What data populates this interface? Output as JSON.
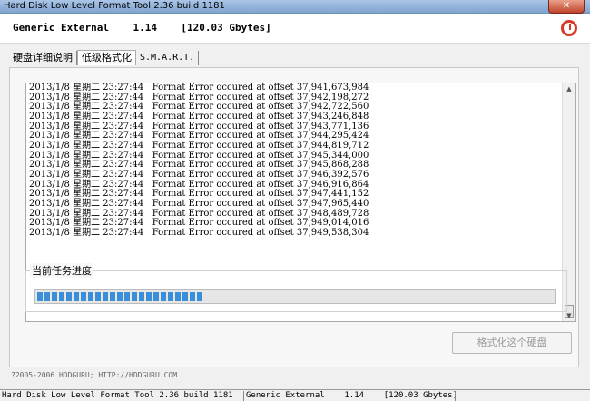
{
  "window": {
    "title": "Hard Disk Low Level Format Tool 2.36 build 1181",
    "close_glyph": "✕"
  },
  "header": {
    "device_text": "Generic External    1.14    [120.03 Gbytes]",
    "app_icon": "hddguru-logo-icon"
  },
  "tabs": [
    {
      "label": "硬盘详细说明"
    },
    {
      "label": "低级格式化"
    },
    {
      "label": "S.M.A.R.T."
    }
  ],
  "log": {
    "lines": [
      "2013/1/8 星期二 23:27:44   Format Error occured at offset 37,941,673,984",
      "2013/1/8 星期二 23:27:44   Format Error occured at offset 37,942,198,272",
      "2013/1/8 星期二 23:27:44   Format Error occured at offset 37,942,722,560",
      "2013/1/8 星期二 23:27:44   Format Error occured at offset 37,943,246,848",
      "2013/1/8 星期二 23:27:44   Format Error occured at offset 37,943,771,136",
      "2013/1/8 星期二 23:27:44   Format Error occured at offset 37,944,295,424",
      "2013/1/8 星期二 23:27:44   Format Error occured at offset 37,944,819,712",
      "2013/1/8 星期二 23:27:44   Format Error occured at offset 37,945,344,000",
      "2013/1/8 星期二 23:27:44   Format Error occured at offset 37,945,868,288",
      "2013/1/8 星期二 23:27:44   Format Error occured at offset 37,946,392,576",
      "2013/1/8 星期二 23:27:44   Format Error occured at offset 37,946,916,864",
      "2013/1/8 星期二 23:27:44   Format Error occured at offset 37,947,441,152",
      "2013/1/8 星期二 23:27:44   Format Error occured at offset 37,947,965,440",
      "2013/1/8 星期二 23:27:44   Format Error occured at offset 37,948,489,728",
      "2013/1/8 星期二 23:27:44   Format Error occured at offset 37,949,014,016",
      "2013/1/8 星期二 23:27:44   Format Error occured at offset 37,949,538,304"
    ],
    "scroll_up_glyph": "▲",
    "scroll_down_glyph": "▼"
  },
  "progress": {
    "label": "当前任务进度",
    "percent": 32,
    "color": "#3b8ed8"
  },
  "format_button": {
    "label": "格式化这个硬盘"
  },
  "footer": {
    "copyright": "?2005-2006 HDDGURU;   HTTP://HDDGURU.COM"
  },
  "statusbar": {
    "app": "Hard Disk Low Level Format Tool 2.36 build 1181",
    "device": "Generic External    1.14    [120.03 Gbytes]"
  }
}
